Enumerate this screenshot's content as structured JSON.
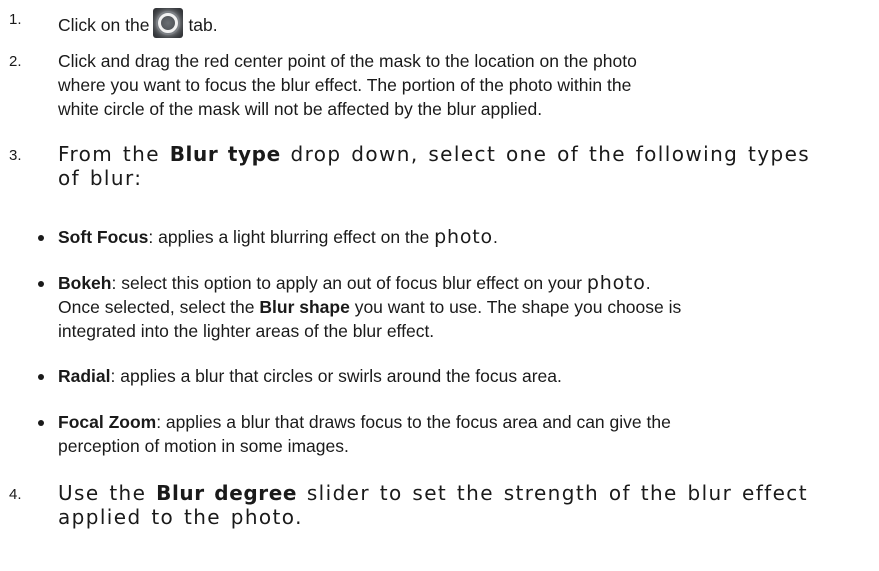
{
  "steps": [
    {
      "number": "1.",
      "before_icon": "Click on the",
      "icon": "focus-ring-tab-icon",
      "after_icon": "tab."
    },
    {
      "number": "2.",
      "lines": [
        "Click and drag the red center point of the mask to the location on the photo",
        "where you want to focus the blur effect. The portion of the photo within the",
        "white circle of the mask will not be affected by the blur applied."
      ]
    },
    {
      "number": "3.",
      "pre": "From the",
      "bold": "Blur type",
      "post": "drop down, select one of the following types",
      "line2": "of blur:"
    },
    {
      "number": "4.",
      "pre": "Use the",
      "bold": "Blur degree",
      "post": "slider to set the strength of the blur effect",
      "line2": "applied to the photo."
    }
  ],
  "blur_types": [
    {
      "name": "Soft Focus",
      "line1": ": applies a light blurring effect on the",
      "line1_end": "photo",
      "line1_tail": "."
    },
    {
      "name": "Bokeh",
      "line1": ": select this option to apply an out of focus blur effect on your",
      "line1_end": "photo",
      "line1_tail": ".",
      "line2_pre": "Once selected, select the",
      "line2_bold": "Blur shape",
      "line2_post": "you want to use. The shape you choose is",
      "line3": "integrated into the lighter areas of the blur effect."
    },
    {
      "name": "Radial",
      "line1": ": applies a blur that circles or swirls around the focus area."
    },
    {
      "name": "Focal Zoom",
      "line1": ": applies a blur that draws focus to the focus area and can give the",
      "line2": "perception of motion in some images."
    }
  ]
}
